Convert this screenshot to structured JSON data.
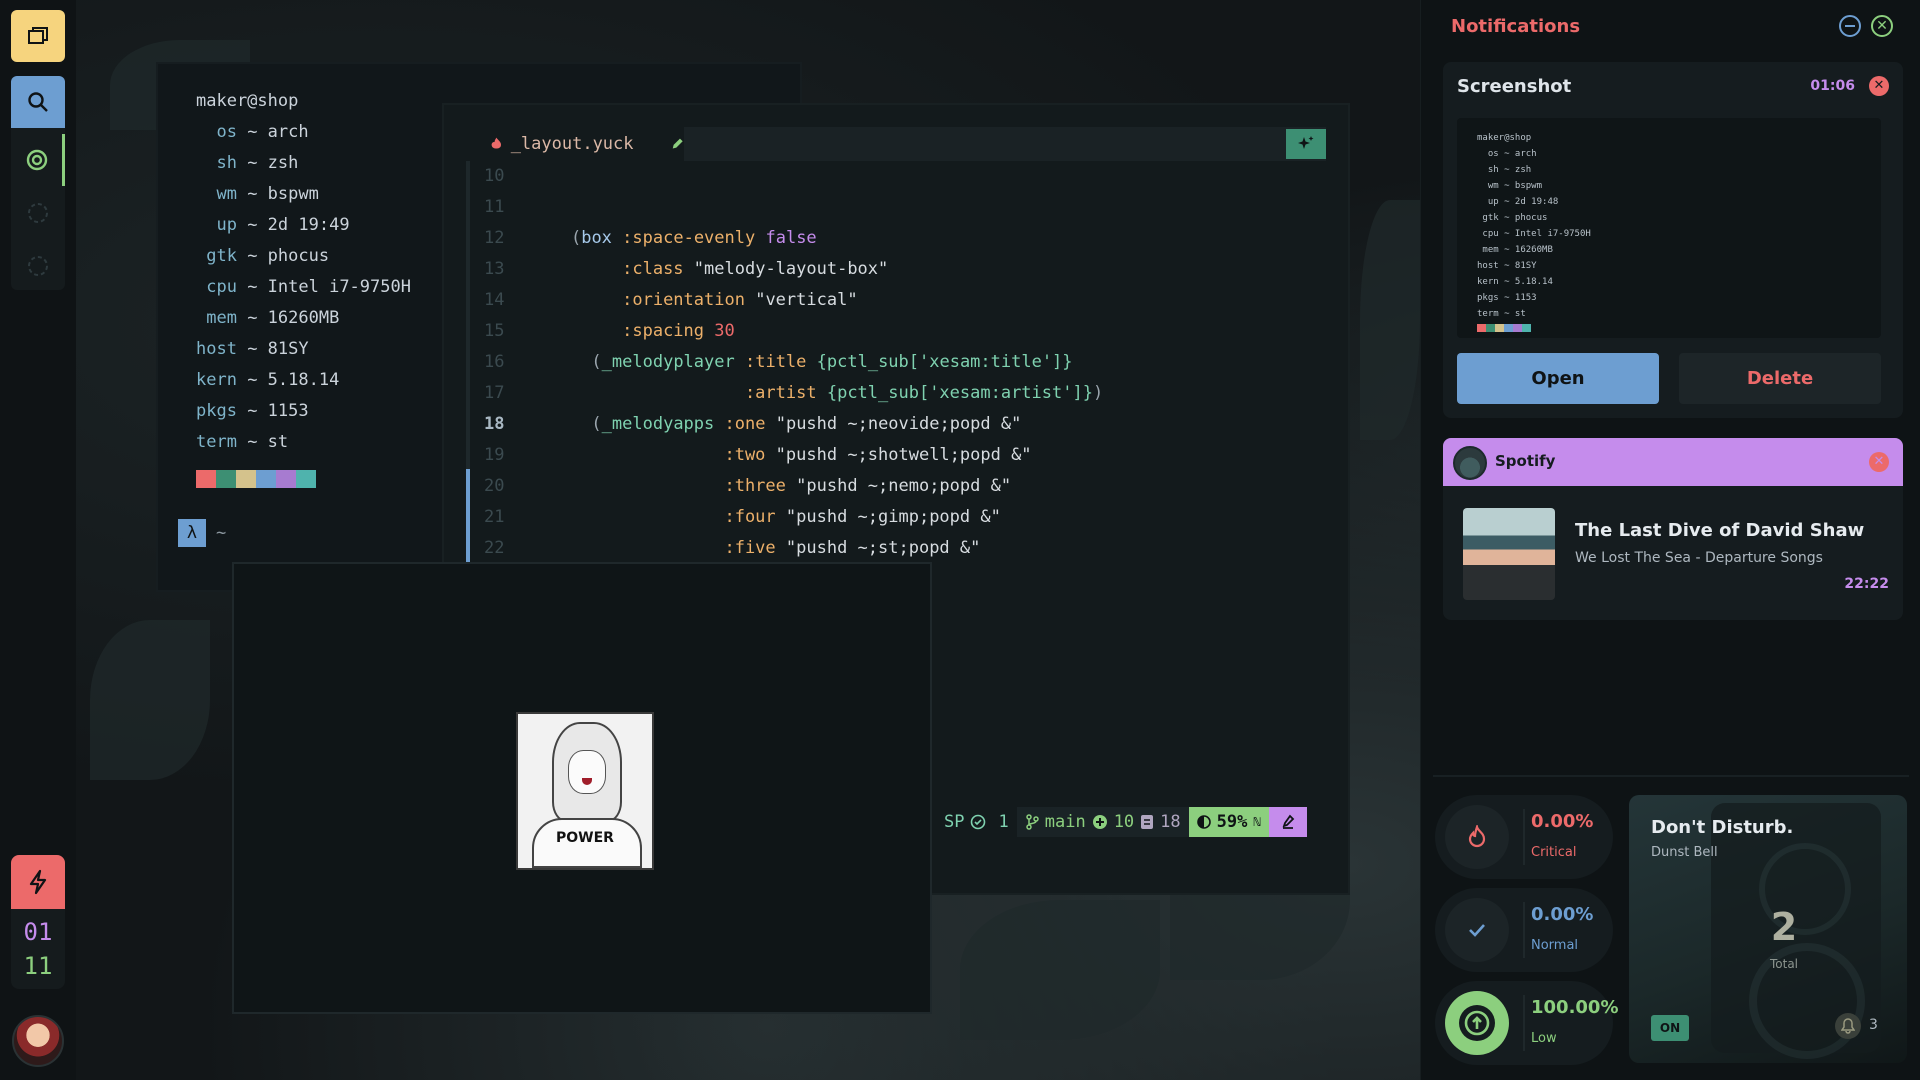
{
  "colors": {
    "red": "#ec6a6a",
    "blue": "#6d9ed1",
    "green": "#8ccf7e",
    "purple": "#c58cec",
    "teal": "#7fd2b0",
    "bg": "#121618",
    "panel": "#151c1f"
  },
  "sidebar": {
    "icons": [
      "windows-icon",
      "search-icon",
      "workspace-active-icon",
      "workspace-empty-icon",
      "workspace-empty-icon"
    ],
    "clock": {
      "hour": "01",
      "minute": "11"
    }
  },
  "fetch": {
    "header": "maker@shop",
    "rows": [
      {
        "key": "  os",
        "value": "arch"
      },
      {
        "key": "  sh",
        "value": "zsh"
      },
      {
        "key": "  wm",
        "value": "bspwm"
      },
      {
        "key": "  up",
        "value": "2d 19:49"
      },
      {
        "key": " gtk",
        "value": "phocus"
      },
      {
        "key": " cpu",
        "value": "Intel i7-9750H"
      },
      {
        "key": " mem",
        "value": "16260MB"
      },
      {
        "key": "host",
        "value": "81SY"
      },
      {
        "key": "kern",
        "value": "5.18.14"
      },
      {
        "key": "pkgs",
        "value": "1153"
      },
      {
        "key": "term",
        "value": "st"
      }
    ],
    "swatches": [
      "#ec6a6a",
      "#3d8f73",
      "#d4c28c",
      "#6d9ed1",
      "#a77bd0",
      "#4fb3ad"
    ],
    "prompt_symbol": "λ",
    "prompt_path": "~"
  },
  "editor": {
    "filename": "_layout.yuck",
    "status": {
      "mode": "SP",
      "diagnostics": "1",
      "branch": "main",
      "added": "10",
      "changed": "18",
      "percent": "59%",
      "percent_suffix": "ℕ"
    }
  },
  "image": {
    "caption": "POWER"
  },
  "notifications": {
    "title": "Notifications",
    "screenshot": {
      "title": "Screenshot",
      "time": "01:06",
      "preview": [
        "maker@shop",
        "  os ~ arch",
        "  sh ~ zsh",
        "  wm ~ bspwm",
        "  up ~ 2d 19:48",
        " gtk ~ phocus",
        " cpu ~ Intel i7-9750H",
        " mem ~ 16260MB",
        "host ~ 81SY",
        "kern ~ 5.18.14",
        "pkgs ~ 1153",
        "term ~ st"
      ],
      "open_label": "Open",
      "delete_label": "Delete"
    },
    "spotify": {
      "app": "Spotify",
      "song": "The Last Dive of David Shaw",
      "artist": "We Lost The Sea - Departure Songs",
      "time": "22:22"
    },
    "stats": {
      "critical": {
        "percent": "0.00%",
        "label": "Critical",
        "value": 0.0
      },
      "normal": {
        "percent": "0.00%",
        "label": "Normal",
        "value": 0.0
      },
      "low": {
        "percent": "100.00%",
        "label": "Low",
        "value": 100.0
      }
    },
    "dnd": {
      "title": "Don't Disturb.",
      "subtitle": "Dunst Bell",
      "count": "2",
      "count_label": "Total",
      "toggle": "ON",
      "bell_count": "3"
    }
  }
}
